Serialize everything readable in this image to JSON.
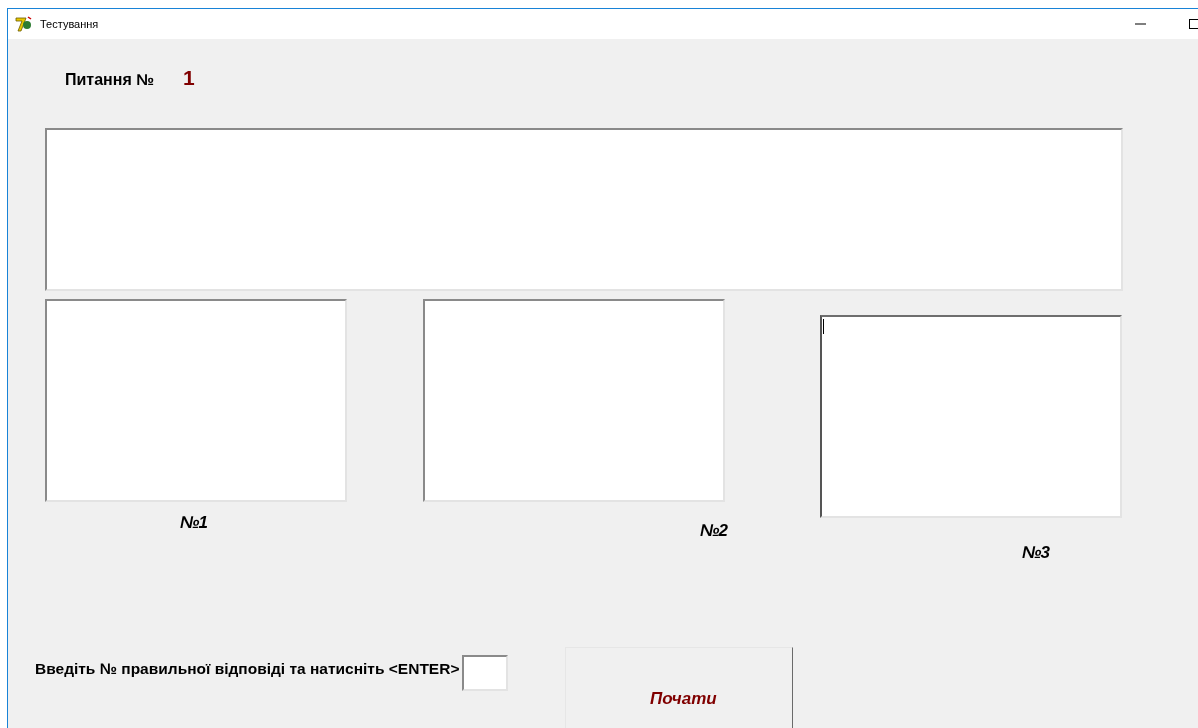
{
  "window": {
    "title": "Тестування"
  },
  "question": {
    "label": "Питання №",
    "number": "1"
  },
  "answers": [
    {
      "label": "№1",
      "focused": false
    },
    {
      "label": "№2",
      "focused": false
    },
    {
      "label": "№3",
      "focused": true
    }
  ],
  "prompt": "Введіть № правильної відповіді та натисніть <ENTER>",
  "start_button": {
    "label": "Почати"
  }
}
